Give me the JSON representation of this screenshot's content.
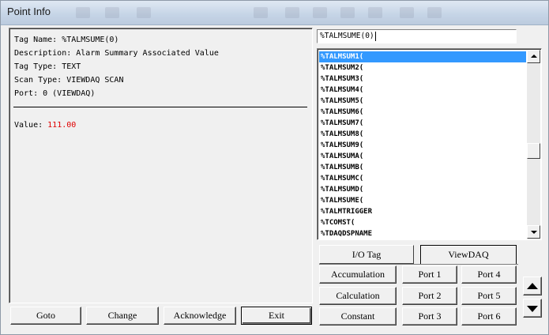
{
  "window": {
    "title": "Point Info"
  },
  "info": {
    "tag_name": "Tag Name: %TALMSUME(0)",
    "description": "Description: Alarm Summary Associated Value",
    "tag_type": "Tag Type: TEXT",
    "scan_type": "Scan Type: VIEWDAQ SCAN",
    "port": "Port: 0 (VIEWDAQ)",
    "value_label": "Value: ",
    "value": "111.00",
    "value_color": "#e00000"
  },
  "bottom_buttons": {
    "goto": "Goto",
    "change": "Change",
    "acknowledge": "Acknowledge",
    "exit": "Exit"
  },
  "search": {
    "value": "%TALMSUME(0)"
  },
  "list": {
    "items": [
      "%TALMSUM1(",
      "%TALMSUM2(",
      "%TALMSUM3(",
      "%TALMSUM4(",
      "%TALMSUM5(",
      "%TALMSUM6(",
      "%TALMSUM7(",
      "%TALMSUM8(",
      "%TALMSUM9(",
      "%TALMSUMA(",
      "%TALMSUMB(",
      "%TALMSUMC(",
      "%TALMSUMD(",
      "%TALMSUME(",
      "%TALMTRIGGER",
      "%TCOMST(",
      "%TDAQDSPNAME"
    ],
    "selected_index": 0,
    "selection_color": "#3399ff"
  },
  "tabs": {
    "io_tag": "I/O Tag",
    "viewdaq": "ViewDAQ",
    "active": "ViewDAQ"
  },
  "right_buttons": {
    "accumulation": "Accumulation",
    "calculation": "Calculation",
    "constant": "Constant",
    "port1": "Port 1",
    "port2": "Port 2",
    "port3": "Port 3",
    "port4": "Port 4",
    "port5": "Port 5",
    "port6": "Port 6"
  },
  "icons": {
    "scroll_up": "up-arrow-icon",
    "scroll_down": "down-arrow-icon"
  }
}
